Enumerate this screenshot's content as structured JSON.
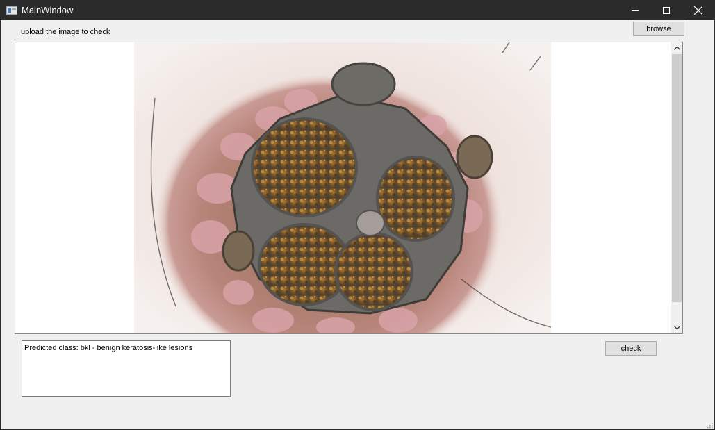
{
  "window": {
    "title": "MainWindow",
    "icons": {
      "app": "app-window-icon",
      "minimize": "minimize-icon",
      "maximize": "maximize-icon",
      "close": "close-icon"
    }
  },
  "main": {
    "prompt_label": "upload the image to check",
    "browse_label": "browse",
    "check_label": "check",
    "result_text": "Predicted class: bkl - benign keratosis-like lesions"
  },
  "colors": {
    "titlebar": "#2b2b2b",
    "background": "#f0f0f0",
    "button": "#e1e1e1"
  }
}
